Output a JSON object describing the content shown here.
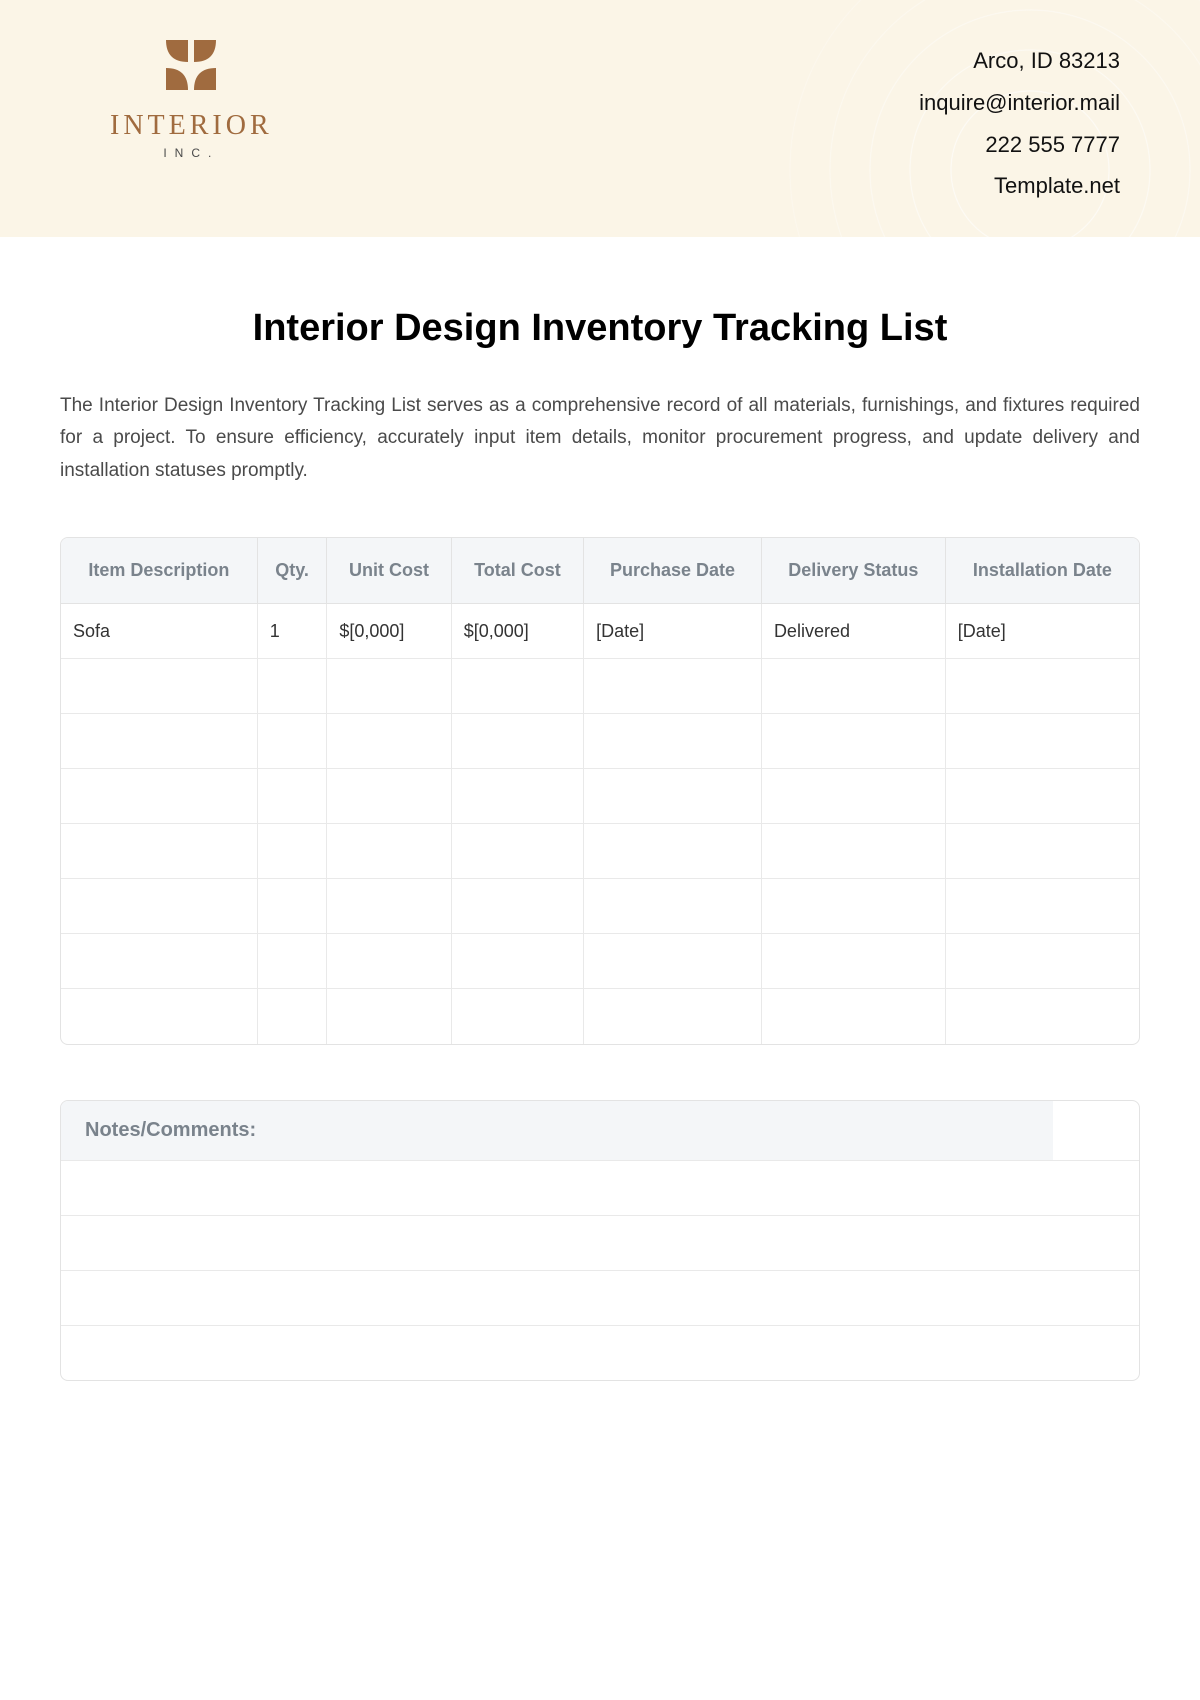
{
  "header": {
    "logo": {
      "name": "INTERIOR",
      "sub": "INC."
    },
    "contact": {
      "address": "Arco, ID 83213",
      "email": "inquire@interior.mail",
      "phone": "222 555 7777",
      "site": "Template.net"
    }
  },
  "title": "Interior Design Inventory Tracking List",
  "intro": "The Interior Design Inventory Tracking List serves as a comprehensive record of all materials, furnishings, and fixtures required for a project. To ensure efficiency, accurately input item details, monitor procurement progress, and update delivery and installation statuses promptly.",
  "table": {
    "headers": {
      "item": "Item Description",
      "qty": "Qty.",
      "unit_cost": "Unit Cost",
      "total_cost": "Total Cost",
      "purchase_date": "Purchase Date",
      "delivery_status": "Delivery Status",
      "installation_date": "Installation Date"
    },
    "rows": [
      {
        "item": "Sofa",
        "qty": "1",
        "unit_cost": "$[0,000]",
        "total_cost": "$[0,000]",
        "purchase_date": "[Date]",
        "delivery_status": "Delivered",
        "installation_date": "[Date]"
      },
      {
        "item": "",
        "qty": "",
        "unit_cost": "",
        "total_cost": "",
        "purchase_date": "",
        "delivery_status": "",
        "installation_date": ""
      },
      {
        "item": "",
        "qty": "",
        "unit_cost": "",
        "total_cost": "",
        "purchase_date": "",
        "delivery_status": "",
        "installation_date": ""
      },
      {
        "item": "",
        "qty": "",
        "unit_cost": "",
        "total_cost": "",
        "purchase_date": "",
        "delivery_status": "",
        "installation_date": ""
      },
      {
        "item": "",
        "qty": "",
        "unit_cost": "",
        "total_cost": "",
        "purchase_date": "",
        "delivery_status": "",
        "installation_date": ""
      },
      {
        "item": "",
        "qty": "",
        "unit_cost": "",
        "total_cost": "",
        "purchase_date": "",
        "delivery_status": "",
        "installation_date": ""
      },
      {
        "item": "",
        "qty": "",
        "unit_cost": "",
        "total_cost": "",
        "purchase_date": "",
        "delivery_status": "",
        "installation_date": ""
      },
      {
        "item": "",
        "qty": "",
        "unit_cost": "",
        "total_cost": "",
        "purchase_date": "",
        "delivery_status": "",
        "installation_date": ""
      }
    ]
  },
  "notes_label": "Notes/Comments:"
}
